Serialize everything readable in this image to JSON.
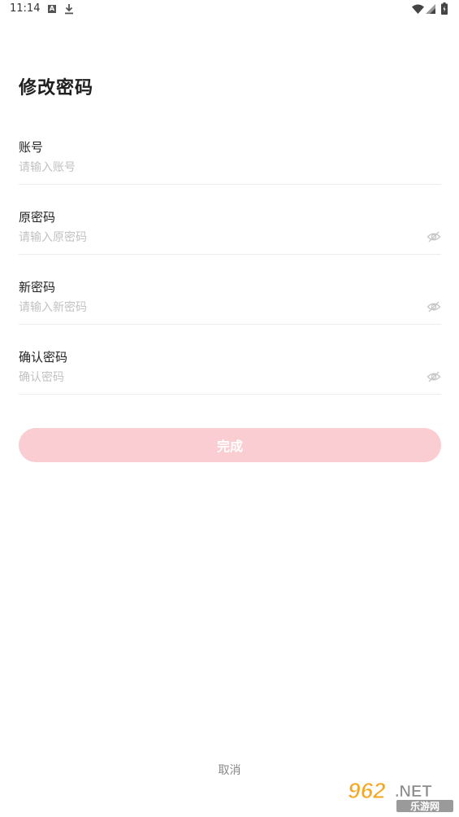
{
  "status_bar": {
    "time": "11:14",
    "icons": [
      "a-icon",
      "download-icon",
      "wifi-icon",
      "signal-icon",
      "battery-icon"
    ]
  },
  "page": {
    "title": "修改密码"
  },
  "form": {
    "account": {
      "label": "账号",
      "placeholder": "请输入账号",
      "value": ""
    },
    "old_password": {
      "label": "原密码",
      "placeholder": "请输入原密码",
      "value": ""
    },
    "new_password": {
      "label": "新密码",
      "placeholder": "请输入新密码",
      "value": ""
    },
    "confirm_password": {
      "label": "确认密码",
      "placeholder": "确认密码",
      "value": ""
    }
  },
  "actions": {
    "submit_label": "完成",
    "cancel_label": "取消"
  },
  "watermark": {
    "text_main": "962",
    "text_suffix": ".NET",
    "text_sub": "乐游网"
  },
  "colors": {
    "button_bg": "#f9cdd1",
    "placeholder": "#c2c2c2",
    "divider": "#ececec"
  }
}
